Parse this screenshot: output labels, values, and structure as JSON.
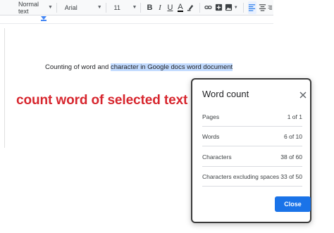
{
  "toolbar": {
    "style_select": "Normal text",
    "font_select": "Arial",
    "size_select": "11",
    "bold_label": "B",
    "italic_label": "I",
    "underline_label": "U",
    "text_color_label": "A"
  },
  "document": {
    "text_plain": "Counting of word and ",
    "text_selected": "character in Google docs word document"
  },
  "annotation": {
    "text": "count word of selected text",
    "color": "#d7262e"
  },
  "dialog": {
    "title": "Word count",
    "rows": [
      {
        "label": "Pages",
        "value": "1 of 1"
      },
      {
        "label": "Words",
        "value": "6 of 10"
      },
      {
        "label": "Characters",
        "value": "38 of 60"
      },
      {
        "label": "Characters excluding spaces",
        "value": "33 of 50"
      }
    ],
    "close_button": "Close",
    "accent_color": "#1a73e8"
  }
}
